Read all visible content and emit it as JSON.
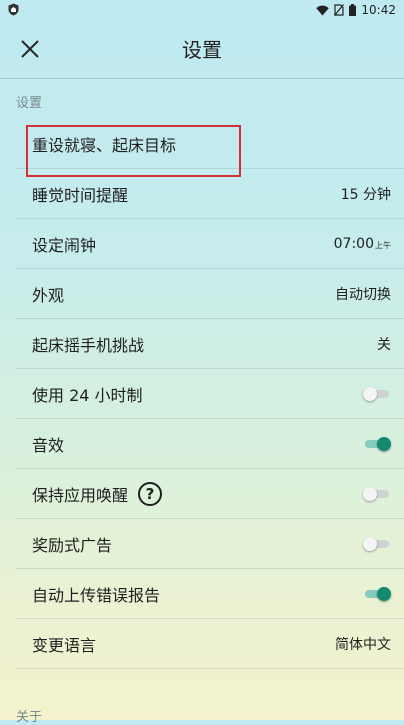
{
  "status_bar": {
    "time": "10:42",
    "icons": [
      "shield-icon",
      "wifi-icon",
      "no-sim-icon",
      "battery-icon"
    ]
  },
  "header": {
    "title": "设置",
    "close_icon": "close-icon"
  },
  "section_settings": "设置",
  "rows": {
    "reset_goal": {
      "label": "重设就寝、起床目标"
    },
    "sleep_reminder": {
      "label": "睡觉时间提醒",
      "value": "15 分钟"
    },
    "set_alarm": {
      "label": "设定闹钟",
      "value": "07:00",
      "ampm": "上午"
    },
    "appearance": {
      "label": "外观",
      "value": "自动切换"
    },
    "shake_challenge": {
      "label": "起床摇手机挑战",
      "value": "关"
    },
    "use_24h": {
      "label": "使用 24 小时制",
      "toggle": false
    },
    "sound": {
      "label": "音效",
      "toggle": true
    },
    "keep_awake": {
      "label": "保持应用唤醒",
      "help": "?",
      "toggle": false
    },
    "rewarded_ads": {
      "label": "奖励式广告",
      "toggle": false
    },
    "auto_upload": {
      "label": "自动上传错误报告",
      "toggle": true
    },
    "language": {
      "label": "变更语言",
      "value": "简体中文"
    }
  },
  "section_about": "关于",
  "colors": {
    "toggle_on": "#138a6e",
    "highlight": "#d3313a"
  }
}
